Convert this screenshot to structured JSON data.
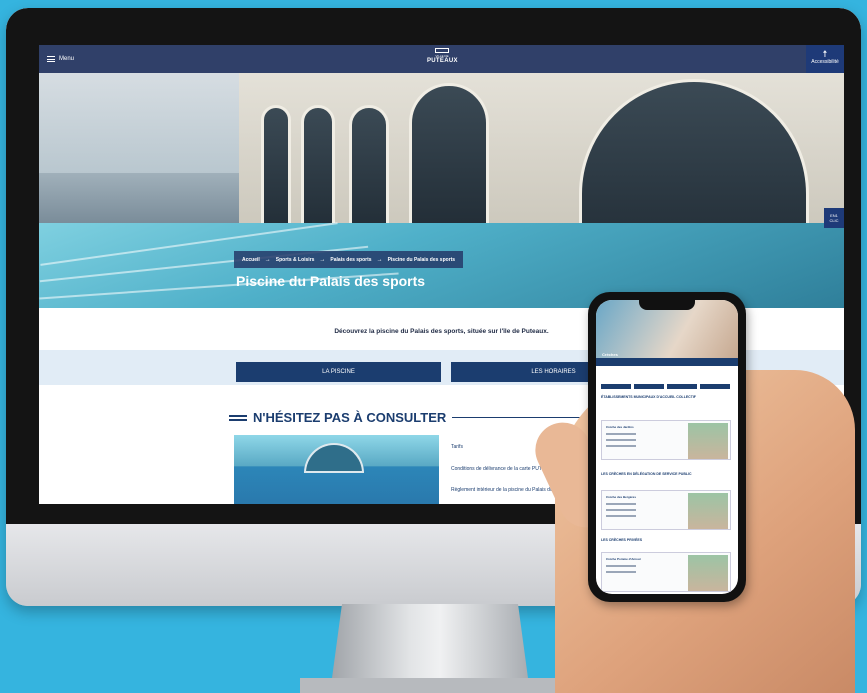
{
  "header": {
    "menu_label": "Menu",
    "logo_small": "VILLE DE",
    "logo_name": "PUTEAUX",
    "accessibility_label": "Accessibilité"
  },
  "hero": {
    "breadcrumb": [
      "Accueil",
      "Sports & Loisirs",
      "Palais des sports",
      "Piscine du Palais des sports"
    ],
    "title": "Piscine du Palais des sports",
    "side_badge": [
      "EN1",
      "CLIC"
    ]
  },
  "intro_text": "Découvrez la piscine du Palais des sports, située sur l'île de Puteaux.",
  "tabs": [
    {
      "label": "LA PISCINE"
    },
    {
      "label": "LES HORAIRES"
    }
  ],
  "consult": {
    "title": "N'HÉSITEZ PAS À CONSULTER",
    "links": [
      "Tarifs",
      "Conditions de délivrance de la carte PUTEAUX PASS",
      "Règlement intérieur de la piscine du Palais du Sport"
    ]
  },
  "phone": {
    "page_title": "Crèches",
    "headings": [
      "ÉTABLISSEMENTS MUNICIPAUX D'ACCUEIL COLLECTIF",
      "LES CRÈCHES EN DÉLÉGATION DE SERVICE PUBLIC",
      "LES CRÈCHES PRIVÉES"
    ],
    "cards": [
      "Crèche des Jardins",
      "Crèche des Bergères",
      "Crèche Pomme d'Amour"
    ]
  },
  "colors": {
    "navy": "#1b3d6f",
    "header": "#1e305c",
    "band": "#e1ecf6",
    "background": "#35b4df"
  }
}
